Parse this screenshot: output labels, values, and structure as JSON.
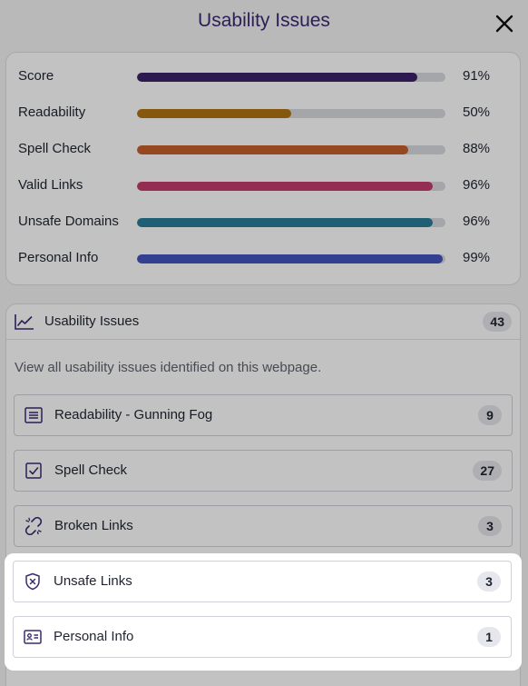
{
  "header": {
    "title": "Usability Issues",
    "close_icon": "close-icon"
  },
  "scores": [
    {
      "label": "Score",
      "value": "91%",
      "fraction": 0.91,
      "color": "#3a2168"
    },
    {
      "label": "Readability",
      "value": "50%",
      "fraction": 0.5,
      "color": "#b07413"
    },
    {
      "label": "Spell Check",
      "value": "88%",
      "fraction": 0.88,
      "color": "#c65f2c"
    },
    {
      "label": "Valid Links",
      "value": "96%",
      "fraction": 0.96,
      "color": "#c43a6c"
    },
    {
      "label": "Unsafe Domains",
      "value": "96%",
      "fraction": 0.96,
      "color": "#2a7e98"
    },
    {
      "label": "Personal Info",
      "value": "99%",
      "fraction": 0.99,
      "color": "#4355c0"
    }
  ],
  "issues_panel": {
    "label": "Usability Issues",
    "count": "43",
    "icon": "trending-chart-icon",
    "description": "View all usability issues identified on this webpage.",
    "items": [
      {
        "label": "Readability - Gunning Fog",
        "count": "9",
        "icon": "text-lines-icon"
      },
      {
        "label": "Spell Check",
        "count": "27",
        "icon": "checkbox-icon"
      },
      {
        "label": "Broken Links",
        "count": "3",
        "icon": "broken-link-icon"
      },
      {
        "label": "Unsafe Links",
        "count": "3",
        "icon": "shield-x-icon"
      },
      {
        "label": "Personal Info",
        "count": "1",
        "icon": "id-card-icon"
      }
    ]
  },
  "colors": {
    "accent": "#3b2a72",
    "icon": "#3b2a72",
    "track": "#d9dae0"
  }
}
